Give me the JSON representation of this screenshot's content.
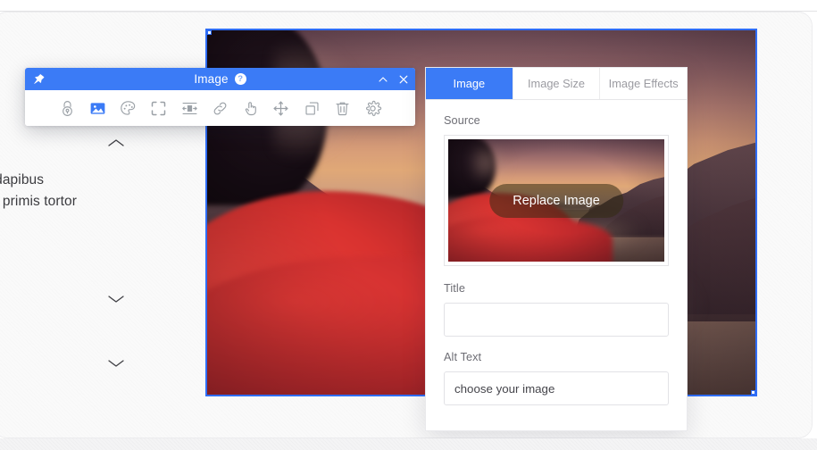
{
  "canvas": {
    "document_text_lines": [
      "udin dapibus",
      "otenti primis tortor"
    ],
    "accordion_chevrons": [
      "chevron-up",
      "chevron-down",
      "chevron-down"
    ]
  },
  "toolbar_window": {
    "pin_icon": "pushpin-icon",
    "title": "Image",
    "help_badge": "?",
    "collapse_icon": "chevron-up-icon",
    "close_icon": "close-icon",
    "tools": [
      {
        "name": "lock-icon",
        "label": "Lock",
        "active": false
      },
      {
        "name": "image-icon",
        "label": "Image",
        "active": true
      },
      {
        "name": "palette-icon",
        "label": "Style",
        "active": false
      },
      {
        "name": "fullscreen-icon",
        "label": "Fullscreen",
        "active": false
      },
      {
        "name": "spacing-icon",
        "label": "Spacing",
        "active": false
      },
      {
        "name": "link-icon",
        "label": "Link",
        "active": false
      },
      {
        "name": "hand-pointer-icon",
        "label": "Select",
        "active": false
      },
      {
        "name": "move-icon",
        "label": "Move",
        "active": false
      },
      {
        "name": "duplicate-icon",
        "label": "Duplicate",
        "active": false
      },
      {
        "name": "trash-icon",
        "label": "Delete",
        "active": false
      },
      {
        "name": "gear-icon",
        "label": "Settings",
        "active": false
      }
    ]
  },
  "panel": {
    "tabs": [
      {
        "label": "Image",
        "active": true
      },
      {
        "label": "Image Size",
        "active": false
      },
      {
        "label": "Image Effects",
        "active": false
      }
    ],
    "source": {
      "label": "Source",
      "replace_button": "Replace Image"
    },
    "title_field": {
      "label": "Title",
      "value": "",
      "placeholder": ""
    },
    "alt_text_field": {
      "label": "Alt Text",
      "value": "choose your image",
      "placeholder": ""
    }
  },
  "colors": {
    "accent_blue": "#3b7bf6",
    "selection_blue": "#2f6df6",
    "panel_border": "#e9e9ec",
    "text_muted": "#9b9ba1"
  }
}
